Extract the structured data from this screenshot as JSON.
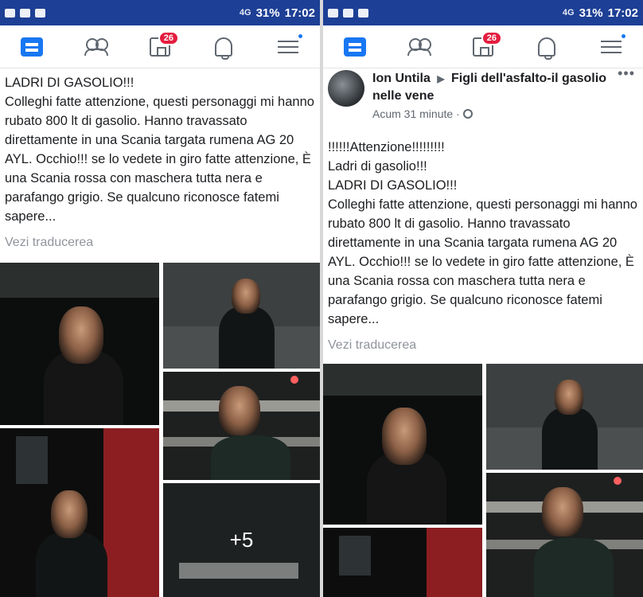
{
  "status_bar": {
    "signal": "4G",
    "battery": "31%",
    "time": "17:02"
  },
  "navbar": {
    "items": [
      "news-feed",
      "friends",
      "marketplace",
      "notifications",
      "menu"
    ],
    "marketplace_badge": "26"
  },
  "left_post": {
    "lines": [
      "LADRI DI GASOLIO!!!",
      "Colleghi fatte attenzione, questi personaggi mi hanno rubato 800 lt di gasolio. Hanno travassato direttamente in una Scania targata rumena AG 20 AYL. Occhio!!! se lo vedete in giro fatte attenzione, È una Scania rossa con maschera tutta nera e parafango grigio. Se qualcuno riconosce fatemi sapere..."
    ],
    "translate_label": "Vezi traducerea",
    "more_photos": "+5"
  },
  "right_post": {
    "author": "Ion Untila",
    "group": "Figli dell'asfalto-il gasolio nelle vene",
    "time": "Acum 31 minute",
    "lines": [
      "!!!!!!Attenzione!!!!!!!!!",
      "Ladri di gasolio!!!",
      "LADRI DI GASOLIO!!!",
      "Colleghi fatte attenzione, questi personaggi mi hanno rubato 800 lt di gasolio. Hanno travassato direttamente in una Scania targata rumena AG 20 AYL. Occhio!!! se lo vedete in giro fatte attenzione, È una Scania rossa con maschera tutta nera e parafango grigio. Se qualcuno riconosce fatemi sapere..."
    ],
    "translate_label": "Vezi traducerea"
  },
  "colors": {
    "status_bar": "#1d3f95",
    "facebook_blue": "#1877f2",
    "badge_red": "#e41e3f"
  }
}
